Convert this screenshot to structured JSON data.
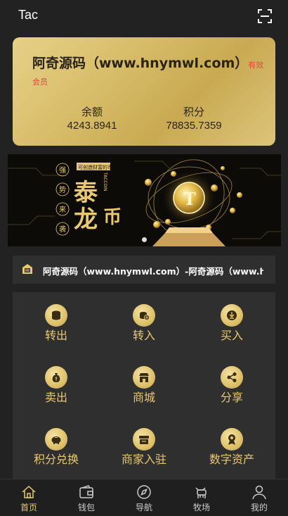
{
  "header": {
    "title": "Tac",
    "scan_icon": "scan-icon"
  },
  "member_card": {
    "name": "阿奇源码（www.hnymwl.com）",
    "badge": "有效会员",
    "balance_label": "余额",
    "balance_value": "4243.8941",
    "points_label": "积分",
    "points_value": "78835.7359"
  },
  "banner": {
    "small_caption": "可创造财富的币",
    "side_chars": [
      "强",
      "势",
      "来",
      "袭"
    ],
    "main_chars": [
      "泰",
      "龙",
      "币"
    ],
    "vertical_text": "TACCOIN",
    "active_slide": 1
  },
  "notice": {
    "icon": "announcement-icon",
    "text": "阿奇源码（www.hnymwl.com）-阿奇源码（www.hnymwl.com）"
  },
  "menu": [
    {
      "label": "转出",
      "icon": "coins-out-icon"
    },
    {
      "label": "转入",
      "icon": "coins-in-icon"
    },
    {
      "label": "买入",
      "icon": "buy-icon"
    },
    {
      "label": "卖出",
      "icon": "money-bag-icon"
    },
    {
      "label": "商城",
      "icon": "store-icon"
    },
    {
      "label": "分享",
      "icon": "share-icon"
    },
    {
      "label": "积分兑换",
      "icon": "piggy-bank-icon"
    },
    {
      "label": "商家入驻",
      "icon": "merchant-icon"
    },
    {
      "label": "数字资产",
      "icon": "award-icon"
    }
  ],
  "tabs": [
    {
      "label": "首页",
      "icon": "home-icon",
      "active": true
    },
    {
      "label": "钱包",
      "icon": "wallet-icon",
      "active": false
    },
    {
      "label": "导航",
      "icon": "compass-icon",
      "active": false
    },
    {
      "label": "牧场",
      "icon": "cow-icon",
      "active": false
    },
    {
      "label": "我的",
      "icon": "user-icon",
      "active": false
    }
  ],
  "colors": {
    "accent_gold": "#e8c870",
    "card_gold": "#d8bd6a",
    "badge_red": "#e0473f",
    "background": "#222222"
  }
}
